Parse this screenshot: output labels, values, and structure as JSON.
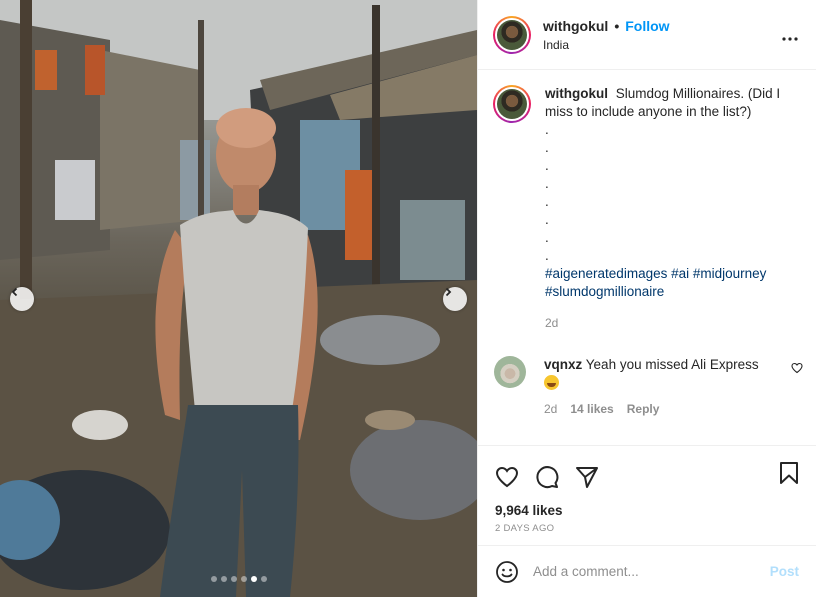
{
  "post": {
    "username": "withgokul",
    "separator": "•",
    "follow_label": "Follow",
    "location": "India",
    "more_icon": "more-horizontal-icon",
    "image": {
      "subject": "photo",
      "carousel_total": 6,
      "carousel_active": 5
    }
  },
  "caption": {
    "username": "withgokul",
    "text": "Slumdog Millionaires. (Did I miss to include anyone in the list?)",
    "dots": [
      ".",
      ".",
      ".",
      ".",
      ".",
      ".",
      ".",
      "."
    ],
    "hashtags": [
      "#aigeneratedimages",
      "#ai",
      "#midjourney",
      "#slumdogmillionaire"
    ],
    "time": "2d"
  },
  "comments": [
    {
      "username": "vqnxz",
      "text": "Yeah you missed Ali Express",
      "emoji": "joy-emoji",
      "time": "2d",
      "likes": "14 likes",
      "reply_label": "Reply"
    }
  ],
  "actions": {
    "likes": "9,964 likes",
    "posted": "2 DAYS AGO"
  },
  "add_comment": {
    "placeholder": "Add a comment...",
    "post_label": "Post"
  },
  "colors": {
    "accent": "#0095f6",
    "hashtag": "#00376b",
    "muted": "#8e8e8e",
    "post_disabled": "#b2dffc"
  }
}
